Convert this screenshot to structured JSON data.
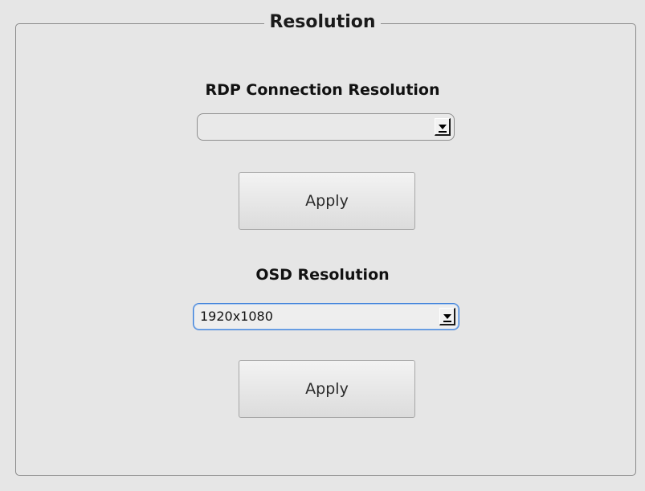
{
  "groupbox": {
    "title": "Resolution"
  },
  "rdp": {
    "label": "RDP Connection Resolution",
    "select_value": "",
    "apply_label": "Apply"
  },
  "osd": {
    "label": "OSD Resolution",
    "select_value": "1920x1080",
    "apply_label": "Apply"
  },
  "icons": {
    "dropdown": "dropdown-arrow-icon"
  }
}
